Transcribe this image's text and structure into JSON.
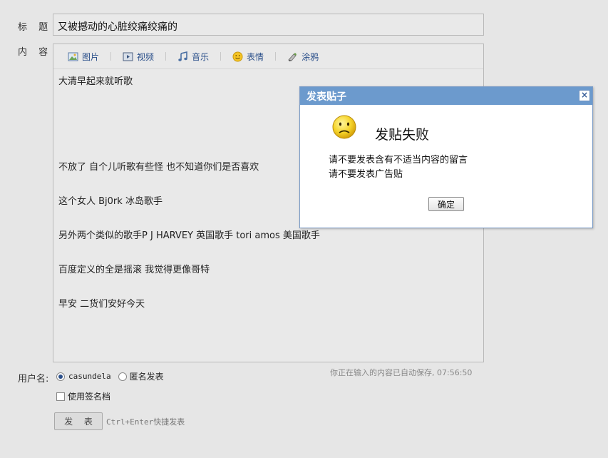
{
  "form": {
    "title_label": "标 题:",
    "content_label": "内 容:",
    "title_value": "又被撼动的心脏绞痛绞痛的",
    "user_label": "用户名:",
    "username": "casundela",
    "anonymous_label": "匿名发表",
    "signature_label": "使用签名档",
    "submit_label": "发 表",
    "submit_hint": "Ctrl+Enter快捷发表",
    "autosave_text": "你正在输入的内容已自动保存, 07:56:50"
  },
  "toolbar": {
    "items": [
      {
        "label": "图片",
        "icon": "image-icon"
      },
      {
        "label": "视频",
        "icon": "video-icon"
      },
      {
        "label": "音乐",
        "icon": "music-icon"
      },
      {
        "label": "表情",
        "icon": "emoticon-icon"
      },
      {
        "label": "涂鸦",
        "icon": "doodle-icon"
      }
    ]
  },
  "content": {
    "lines": [
      "大清早起来就听歌",
      "",
      "",
      "",
      "",
      "不放了 自个儿听歌有些怪 也不知道你们是否喜欢",
      "",
      "这个女人 Bj0rk 冰岛歌手",
      "",
      "另外两个类似的歌手P J HARVEY 英国歌手 tori amos 美国歌手",
      "",
      "百度定义的全是摇滚 我觉得更像哥特",
      "",
      "早安 二货们安好今天"
    ]
  },
  "dialog": {
    "title": "发表贴子",
    "close_label": "×",
    "heading": "发贴失败",
    "message_1": "请不要发表含有不适当内容的留言",
    "message_2": "请不要发表广告贴",
    "ok_label": "确定"
  },
  "colors": {
    "dialog_header": "#6c9acd",
    "link": "#2a4f8a",
    "background": "#e6e6e6"
  }
}
